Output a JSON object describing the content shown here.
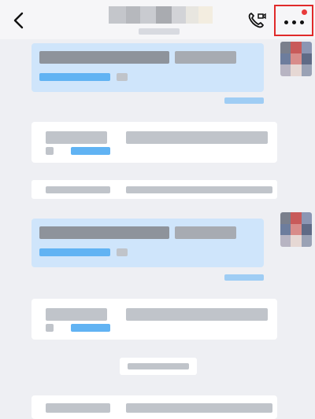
{
  "header": {
    "back_icon": "chevron-left-icon",
    "call_icon": "phone-video-icon",
    "more_icon": "more-horizontal-icon",
    "notification_color": "#e83b3b",
    "highlight_color": "#e02a2a"
  },
  "colors": {
    "background": "#eeeff3",
    "outgoing_bubble": "#cfe5fb",
    "incoming_card": "#ffffff",
    "link_blue": "#61b3f3"
  }
}
